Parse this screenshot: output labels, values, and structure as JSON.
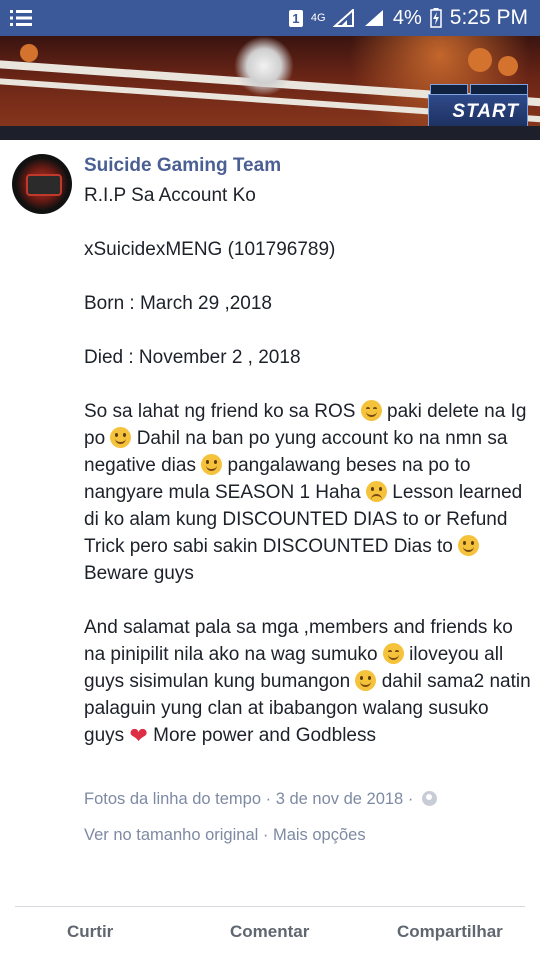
{
  "status_bar": {
    "sim_label": "1",
    "network_label": "4G",
    "battery_percent": "4%",
    "time": "5:25 PM",
    "icons": [
      "menu-icon",
      "sim-icon",
      "network-icon",
      "signal-icon",
      "battery-icon"
    ]
  },
  "banner": {
    "start_label": "START"
  },
  "post": {
    "poster_name": "Suicide Gaming Team",
    "lines": {
      "title": "R.I.P Sa Account Ko",
      "account": "xSuicidexMENG (101796789)",
      "born": "Born : March 29 ,2018",
      "died": "Died : November 2 , 2018",
      "para1_a": "So sa lahat ng friend ko sa ROS ",
      "para1_b": " paki delete na Ig po ",
      "para1_c": " Dahil na ban po yung account ko na nmn sa negative dias ",
      "para1_d": " pangalawang beses na po to nangyare mula SEASON 1 Haha ",
      "para1_e": " Lesson learned di ko alam kung DISCOUNTED DIAS to or Refund Trick pero sabi sakin DISCOUNTED Dias to ",
      "para1_f": " Beware guys",
      "para2_a": "And salamat pala sa mga ,members and friends ko na pinipilit nila ako na wag sumuko ",
      "para2_b": " iloveyou all guys sisimulan kung bumangon ",
      "para2_c": " dahil sama2 natin palaguin yung clan at ibabangon walang susuko guys ",
      "para2_d": " More power and Godbless"
    },
    "meta": {
      "album": "Fotos da linha do tempo",
      "separator": " · ",
      "date": "3 de nov de 2018",
      "separator2": " · "
    },
    "links": {
      "full_size": "Ver no tamanho original",
      "separator": " · ",
      "more_options": "Mais opções"
    }
  },
  "actions": {
    "like": "Curtir",
    "comment": "Comentar",
    "share": "Compartilhar"
  },
  "colors": {
    "status_bar": "#3b5998",
    "poster_name": "#4b5f94",
    "meta_text": "#7e8aa3",
    "action_text": "#606770"
  }
}
